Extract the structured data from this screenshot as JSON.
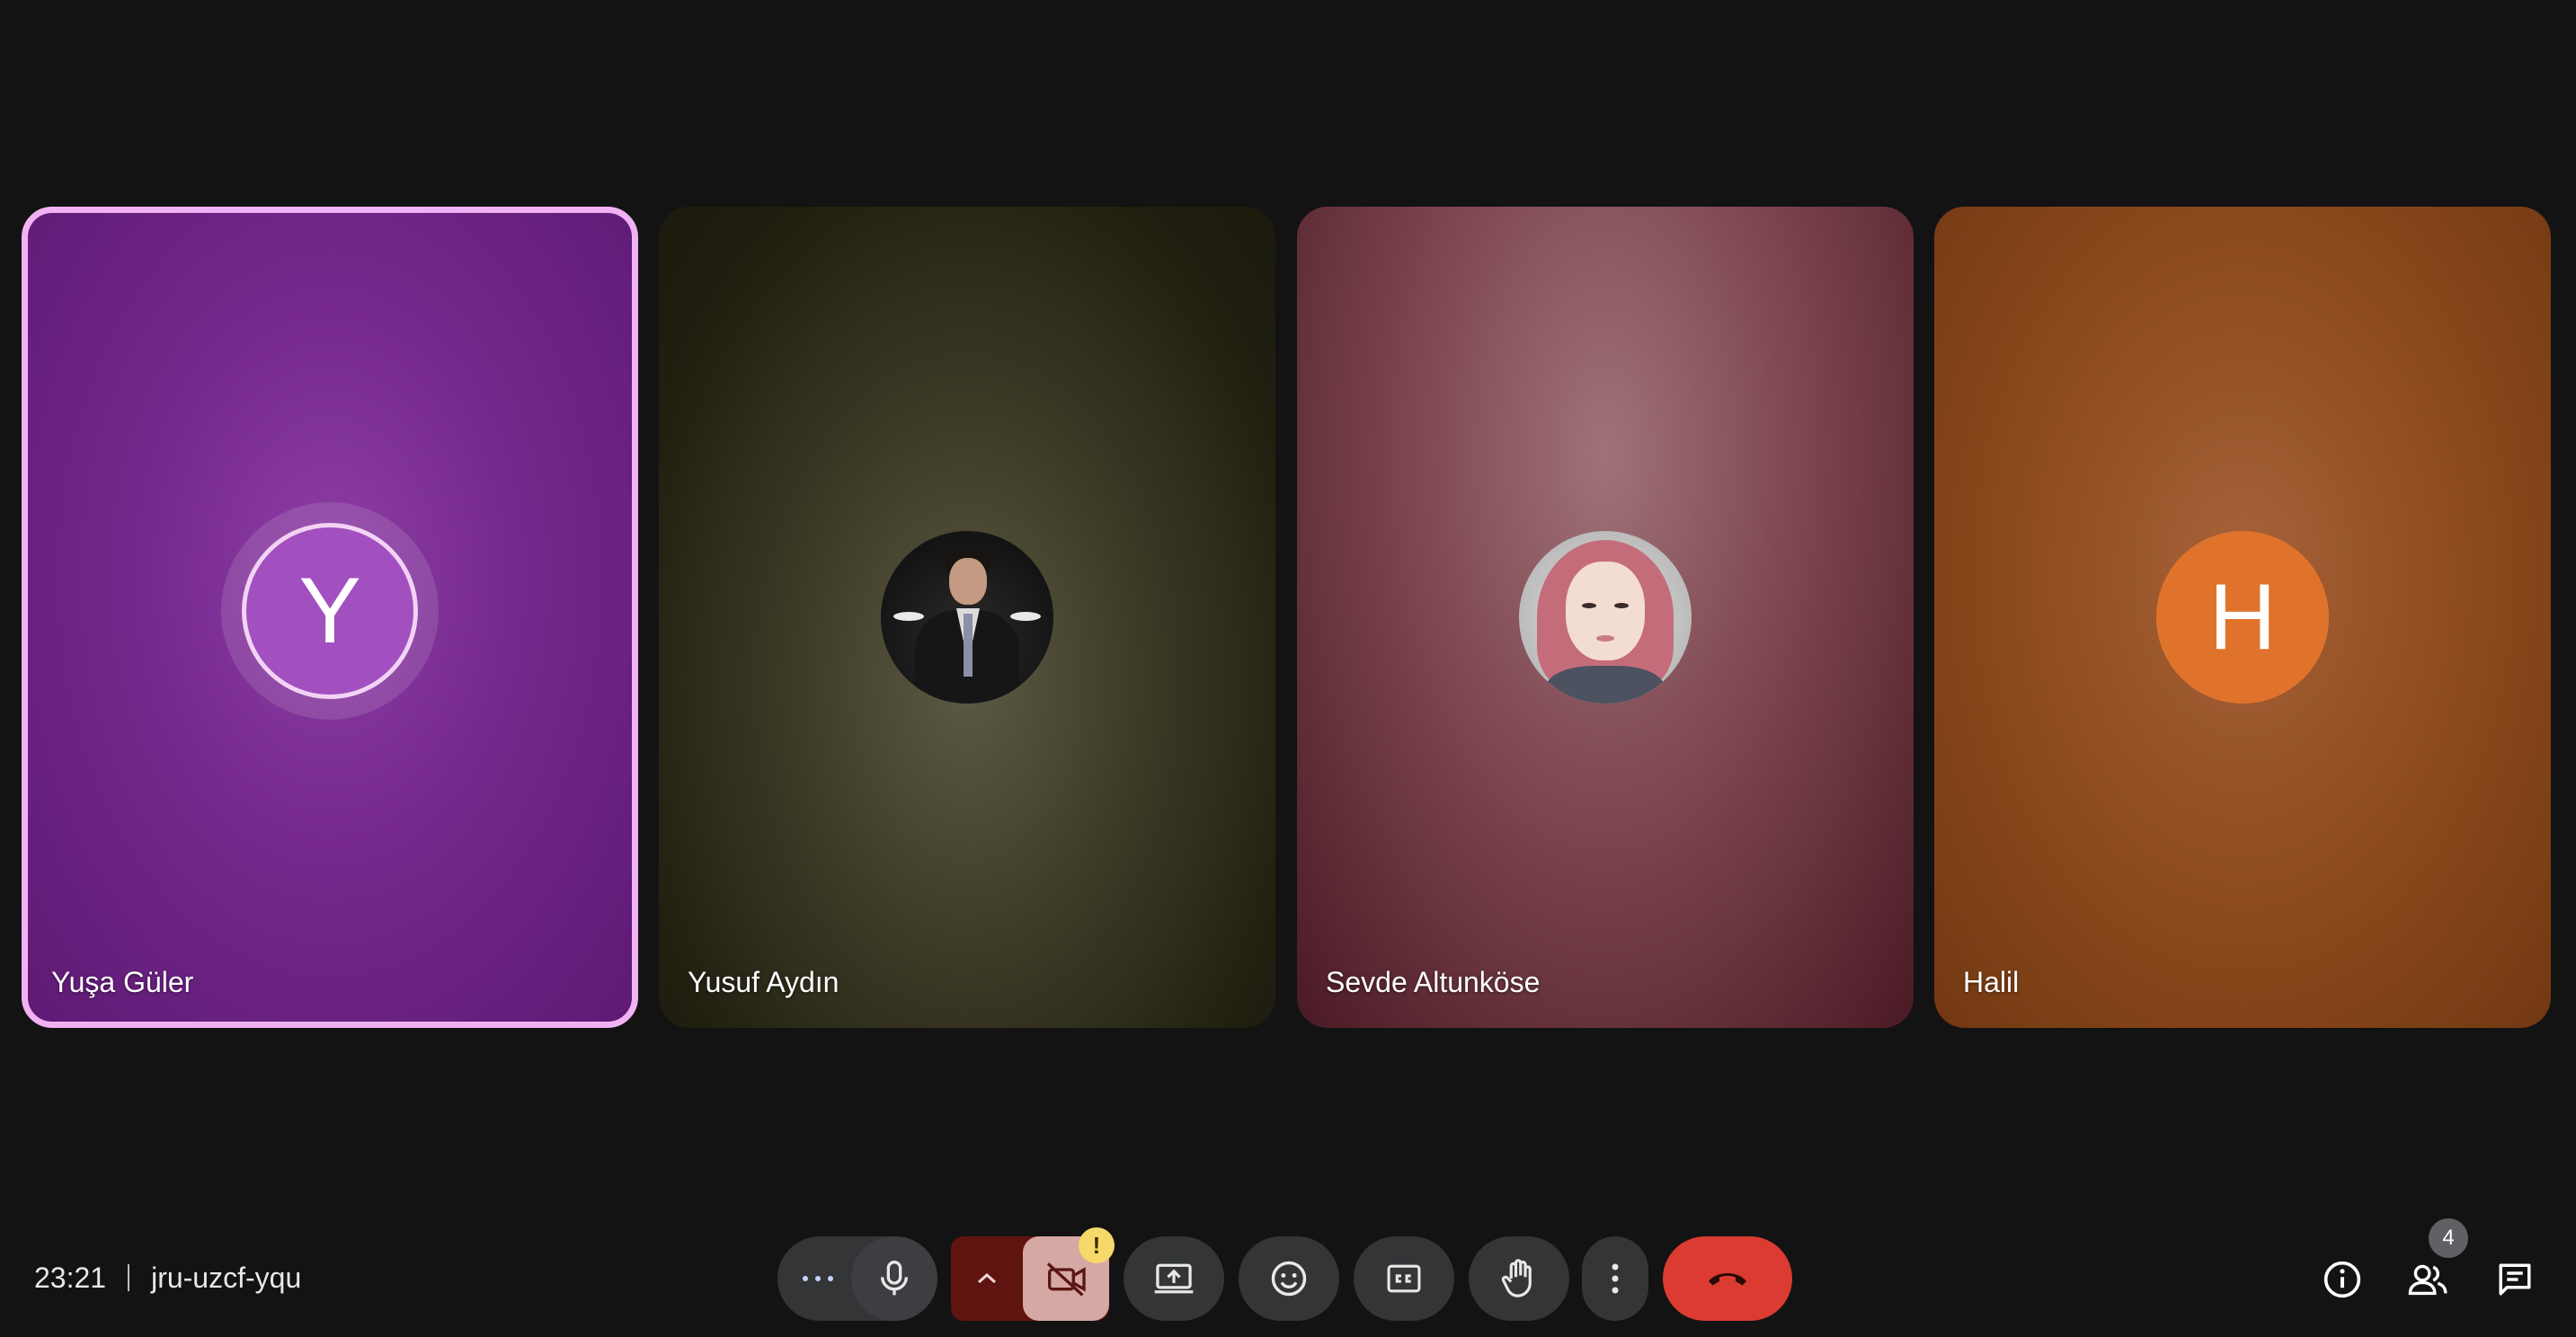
{
  "participants": [
    {
      "name": "Yuşa Güler",
      "initial": "Y",
      "avatar_color": "#a24fbf",
      "tile_color": "#74278c",
      "speaking": true
    },
    {
      "name": "Yusuf Aydın",
      "photo": true,
      "tile_color": "#2a2818"
    },
    {
      "name": "Sevde Altunköse",
      "photo": true,
      "tile_color": "#7d4650"
    },
    {
      "name": "Halil",
      "initial": "H",
      "avatar_color": "#e0732b",
      "tile_color": "#8e4b1d"
    }
  ],
  "meeting": {
    "time": "23:21",
    "code": "jru-uzcf-yqu"
  },
  "controls": {
    "mic_options_icon": "more-horiz-icon",
    "mic_icon": "microphone-icon",
    "camera_options_icon": "chevron-up-icon",
    "camera_icon": "camera-off-icon",
    "camera_warning": "!",
    "present_icon": "present-screen-icon",
    "emoji_icon": "emoji-icon",
    "captions_icon": "captions-icon",
    "raise_hand_icon": "hand-icon",
    "more_icon": "more-vert-icon",
    "leave_icon": "hang-up-icon",
    "leave_color": "#dc3b32"
  },
  "side": {
    "info_icon": "info-icon",
    "people_icon": "people-icon",
    "people_count": "4",
    "chat_icon": "chat-icon"
  }
}
